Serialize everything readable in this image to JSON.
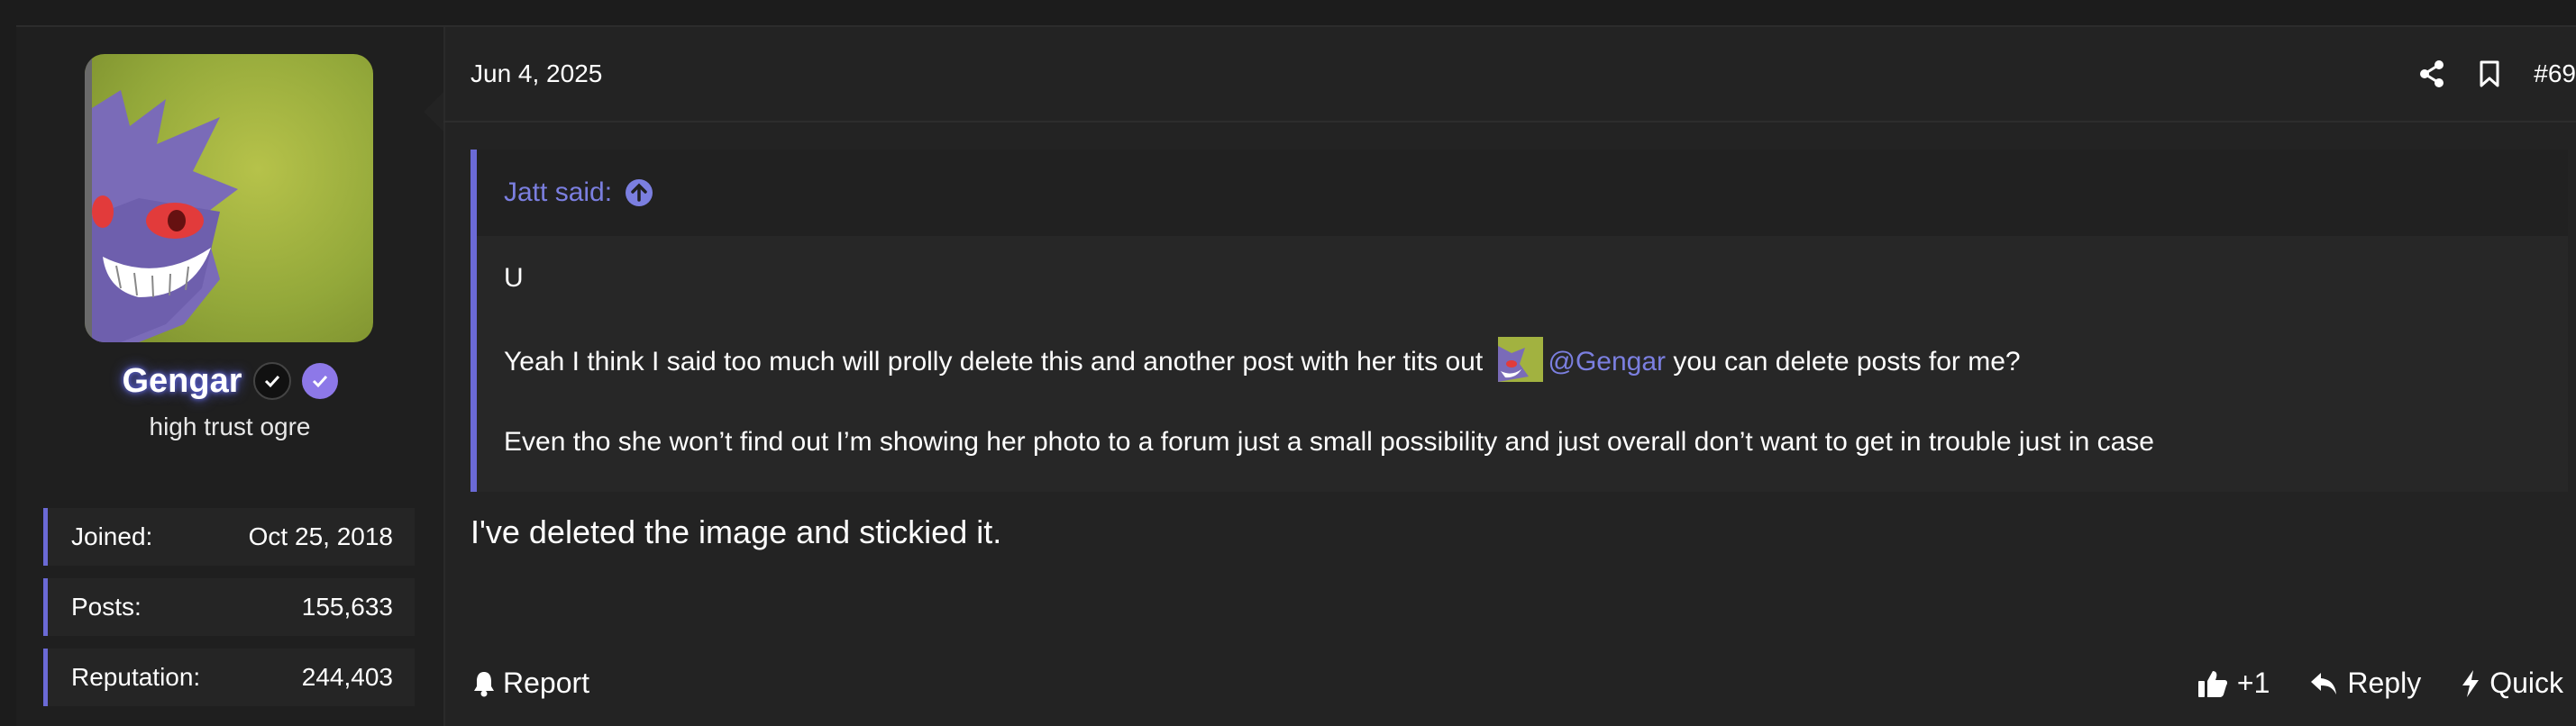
{
  "user": {
    "username": "Gengar",
    "title": "high trust ogre",
    "stats": [
      {
        "label": "Joined:",
        "value": "Oct 25, 2018"
      },
      {
        "label": "Posts:",
        "value": "155,633"
      },
      {
        "label": "Reputation:",
        "value": "244,403"
      }
    ]
  },
  "post": {
    "date": "Jun 4, 2025",
    "number": "#69",
    "quote": {
      "author_label": "Jatt said:",
      "line1": "U",
      "line2_before": "Yeah I think I said too much will prolly delete this and another post with her tits out",
      "mention": "@Gengar",
      "line2_after": "you can delete posts for me?",
      "line3": "Even tho she won’t find out I’m showing her photo to a forum just a small possibility and just overall don’t want to get in trouble just in case"
    },
    "body": "I've deleted the image and stickied it.",
    "footer": {
      "report": "Report",
      "like_count": "+1",
      "reply": "Reply",
      "quick": "Quick"
    }
  },
  "icons": {
    "share": "share-icon",
    "bookmark": "bookmark-icon",
    "expand_quote": "arrow-up-circle-icon",
    "bell": "bell-icon",
    "thumbs_up": "thumbs-up-icon",
    "reply": "reply-icon",
    "bolt": "bolt-icon"
  },
  "colors": {
    "accent": "#6b6ad6",
    "link": "#7b7fe0",
    "verified": "#8d78e8"
  }
}
